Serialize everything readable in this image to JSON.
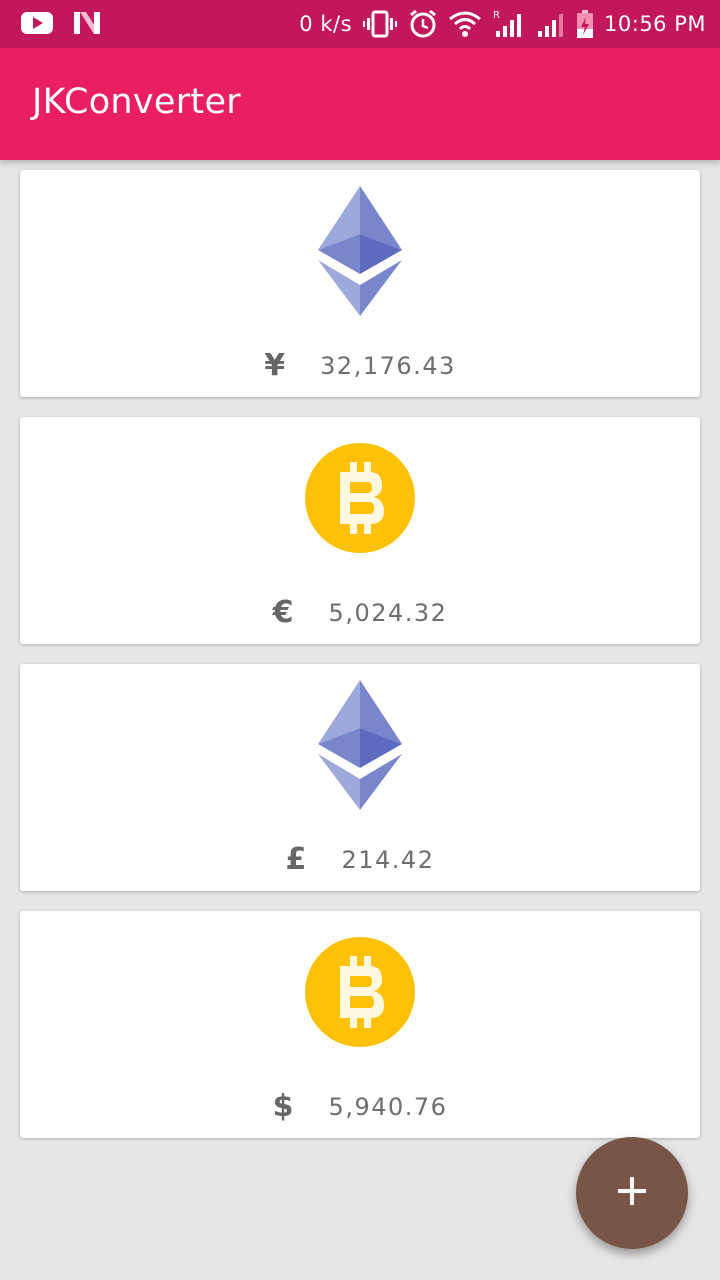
{
  "status_bar": {
    "left_icons": [
      "youtube-icon",
      "n-logo-icon"
    ],
    "network_speed": "0 k/s",
    "right_icons": [
      "vibrate-icon",
      "alarm-icon",
      "wifi-icon",
      "signal-icon",
      "signal-icon",
      "battery-charging-icon"
    ],
    "roaming_indicator": "R",
    "time": "10:56 PM"
  },
  "app_bar": {
    "title": "JKConverter"
  },
  "cards": [
    {
      "coin_icon": "ethereum-icon",
      "currency_symbol": "¥",
      "amount": "32,176.43"
    },
    {
      "coin_icon": "bitcoin-icon",
      "currency_symbol": "€",
      "amount": "5,024.32"
    },
    {
      "coin_icon": "ethereum-icon",
      "currency_symbol": "£",
      "amount": "214.42"
    },
    {
      "coin_icon": "bitcoin-icon",
      "currency_symbol": "$",
      "amount": "5,940.76"
    }
  ],
  "fab": {
    "icon": "plus-icon"
  },
  "colors": {
    "status_bar": "#c2185b",
    "app_bar": "#e91e63",
    "fab": "#795548",
    "bitcoin": "#ffc107",
    "ethereum": "#7986cb",
    "background": "#e6e6e6"
  }
}
